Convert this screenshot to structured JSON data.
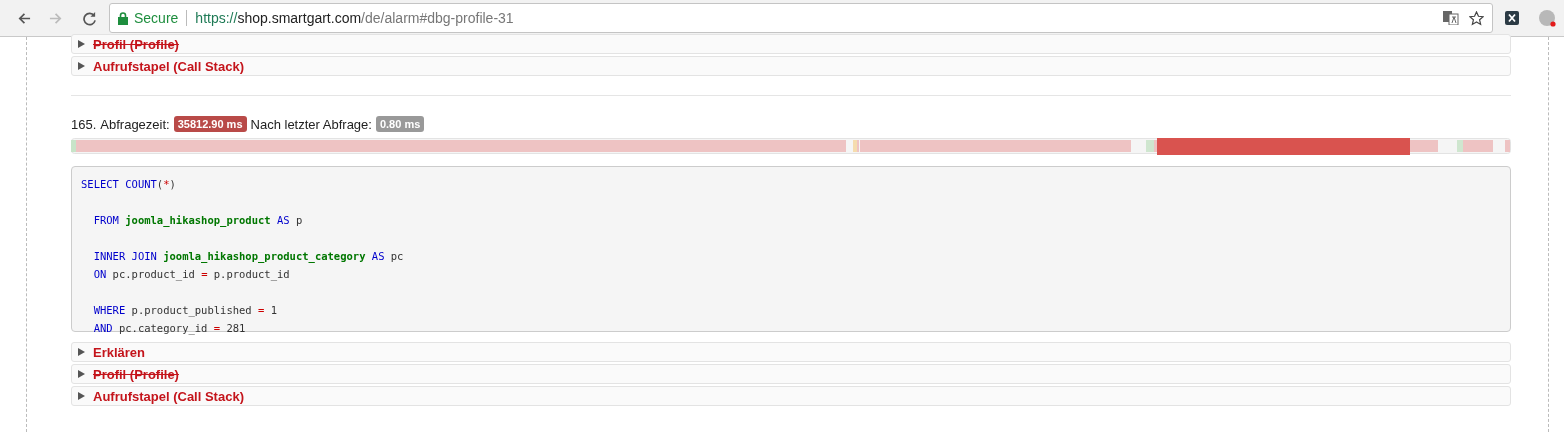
{
  "browser": {
    "security_label": "Secure",
    "url": {
      "scheme": "https://",
      "host": "shop.smartgart.com",
      "path": "/de/alarm#dbg-profile-31"
    }
  },
  "previous_query_panels": [
    {
      "label": "Profil (Profile)",
      "struck": true,
      "expanded": false
    },
    {
      "label": "Aufrufstapel (Call Stack)",
      "struck": false,
      "expanded": false
    }
  ],
  "query": {
    "number": "165.",
    "time_label": "Abfragezeit:",
    "time_badge": {
      "text": "35812.90 ms",
      "kind": "danger"
    },
    "since_label": "Nach letzter Abfrage:",
    "since_badge": {
      "text": "0.80 ms",
      "kind": "default"
    },
    "sql_lines": [
      {
        "kind": "code",
        "tokens": [
          {
            "kind": "keyword",
            "text": "SELECT COUNT"
          },
          {
            "kind": "plain",
            "text": "("
          },
          {
            "kind": "operator",
            "text": "*"
          },
          {
            "kind": "plain",
            "text": ")"
          }
        ]
      },
      {
        "kind": "blank"
      },
      {
        "kind": "code",
        "tokens": [
          {
            "kind": "keyword",
            "text": "  FROM "
          },
          {
            "kind": "table",
            "text": "joomla_hikashop_product"
          },
          {
            "kind": "keyword",
            "text": " AS"
          },
          {
            "kind": "plain",
            "text": " p"
          }
        ]
      },
      {
        "kind": "blank"
      },
      {
        "kind": "code",
        "tokens": [
          {
            "kind": "keyword",
            "text": "  INNER JOIN "
          },
          {
            "kind": "table",
            "text": "joomla_hikashop_product_category"
          },
          {
            "kind": "keyword",
            "text": " AS"
          },
          {
            "kind": "plain",
            "text": " pc"
          }
        ]
      },
      {
        "kind": "code",
        "tokens": [
          {
            "kind": "keyword",
            "text": "  ON"
          },
          {
            "kind": "plain",
            "text": " pc.product_id "
          },
          {
            "kind": "operator",
            "text": "="
          },
          {
            "kind": "plain",
            "text": " p.product_id"
          }
        ]
      },
      {
        "kind": "blank"
      },
      {
        "kind": "code",
        "tokens": [
          {
            "kind": "keyword",
            "text": "  WHERE"
          },
          {
            "kind": "plain",
            "text": " p.product_published "
          },
          {
            "kind": "operator",
            "text": "="
          },
          {
            "kind": "plain",
            "text": " 1"
          }
        ]
      },
      {
        "kind": "code",
        "tokens": [
          {
            "kind": "keyword",
            "text": "  AND"
          },
          {
            "kind": "plain",
            "text": " pc.category_id "
          },
          {
            "kind": "operator",
            "text": "="
          },
          {
            "kind": "plain",
            "text": " 281"
          }
        ]
      }
    ],
    "panels": [
      {
        "label": "Erklären",
        "struck": false,
        "expanded": false
      },
      {
        "label": "Profil (Profile)",
        "struck": true,
        "expanded": false
      },
      {
        "label": "Aufrufstapel (Call Stack)",
        "struck": false,
        "expanded": false
      }
    ]
  }
}
